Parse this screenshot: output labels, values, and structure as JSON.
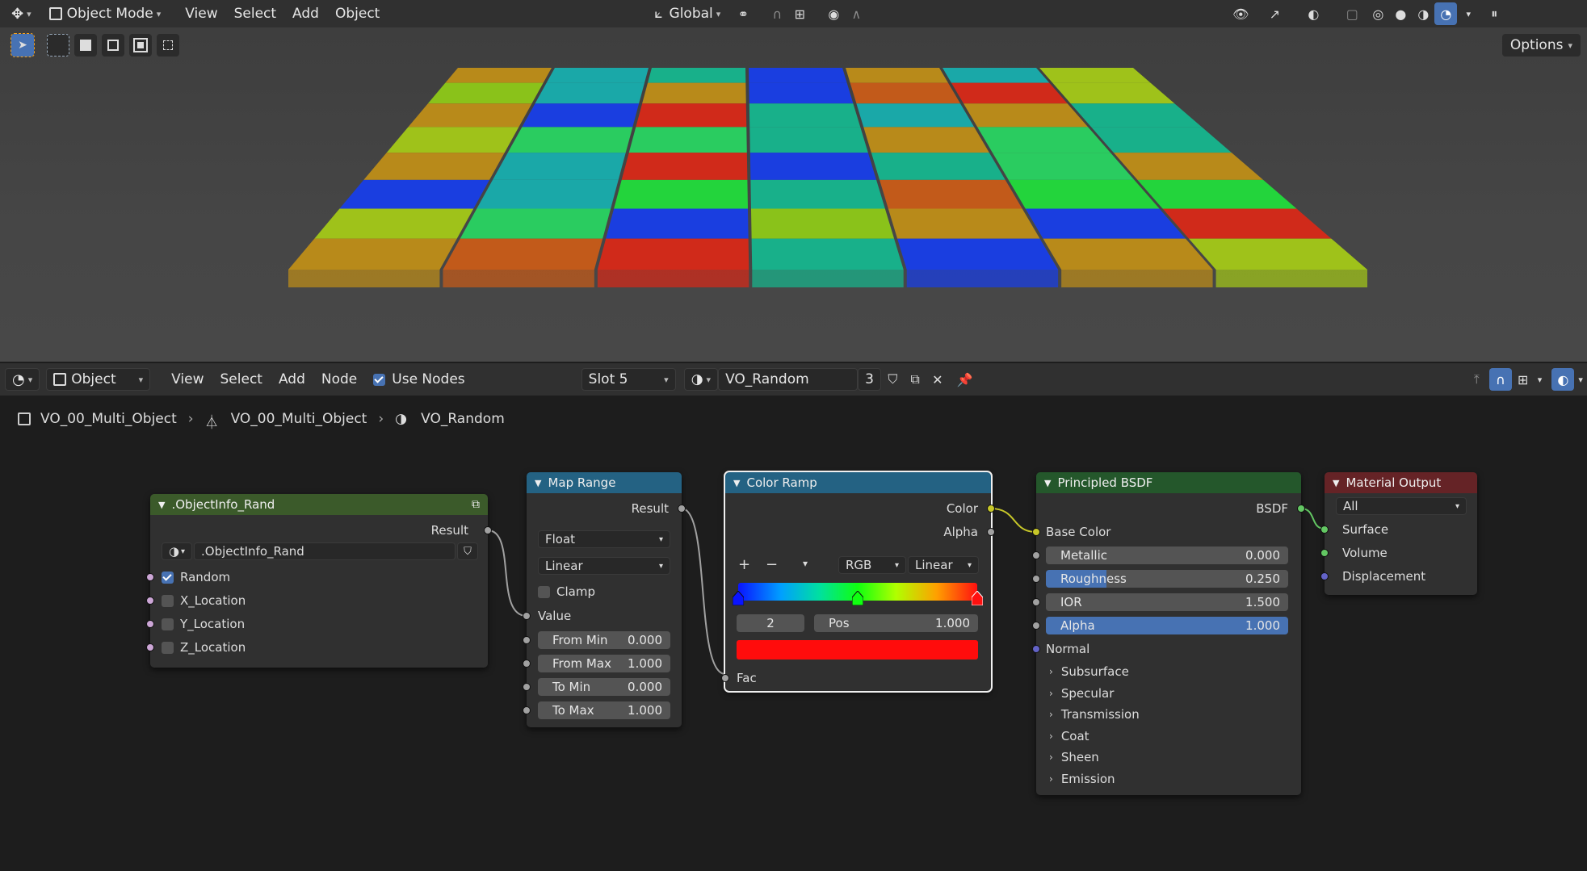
{
  "viewport_header": {
    "mode": "Object Mode",
    "menus": [
      "View",
      "Select",
      "Add",
      "Object"
    ],
    "orientation": "Global",
    "options_label": "Options"
  },
  "node_header": {
    "type": "Object",
    "menus": [
      "View",
      "Select",
      "Add",
      "Node"
    ],
    "use_nodes_label": "Use Nodes",
    "use_nodes_checked": true,
    "slot": "Slot 5",
    "material_name": "VO_Random",
    "user_count": "3"
  },
  "breadcrumb": {
    "object": "VO_00_Multi_Object",
    "mesh": "VO_00_Multi_Object",
    "material": "VO_Random"
  },
  "nodes": {
    "objectinfo": {
      "title": ".ObjectInfo_Rand",
      "output": "Result",
      "group_name": ".ObjectInfo_Rand",
      "inputs": [
        {
          "label": "Random",
          "checked": true
        },
        {
          "label": "X_Location",
          "checked": false
        },
        {
          "label": "Y_Location",
          "checked": false
        },
        {
          "label": "Z_Location",
          "checked": false
        }
      ]
    },
    "maprange": {
      "title": "Map Range",
      "output": "Result",
      "data_type": "Float",
      "interpolation": "Linear",
      "clamp_label": "Clamp",
      "value_label": "Value",
      "fields": [
        {
          "label": "From Min",
          "value": "0.000"
        },
        {
          "label": "From Max",
          "value": "1.000"
        },
        {
          "label": "To Min",
          "value": "0.000"
        },
        {
          "label": "To Max",
          "value": "1.000"
        }
      ]
    },
    "colorramp": {
      "title": "Color Ramp",
      "out_color": "Color",
      "out_alpha": "Alpha",
      "color_mode": "RGB",
      "interpolation": "Linear",
      "stop_index": "2",
      "pos_label": "Pos",
      "pos_value": "1.000",
      "stops": [
        {
          "pos": 0.0,
          "color": "#0a14ff"
        },
        {
          "pos": 0.5,
          "color": "#10ff10"
        },
        {
          "pos": 1.0,
          "color": "#ff1010"
        }
      ],
      "selected_color": "#ff0c0c",
      "input": "Fac"
    },
    "bsdf": {
      "title": "Principled BSDF",
      "output": "BSDF",
      "base_color_label": "Base Color",
      "fields": [
        {
          "label": "Metallic",
          "value": "0.000",
          "fill": 0.0
        },
        {
          "label": "Roughness",
          "value": "0.250",
          "fill": 0.25
        },
        {
          "label": "IOR",
          "value": "1.500",
          "fill": 0.0
        },
        {
          "label": "Alpha",
          "value": "1.000",
          "fill": 1.0
        }
      ],
      "normal_label": "Normal",
      "panels": [
        "Subsurface",
        "Specular",
        "Transmission",
        "Coat",
        "Sheen",
        "Emission"
      ]
    },
    "output": {
      "title": "Material Output",
      "target": "All",
      "inputs": [
        "Surface",
        "Volume",
        "Displacement"
      ]
    }
  },
  "colors": {
    "accent": "#4772b3",
    "header_shader": "#24572b",
    "header_converter": "#246283",
    "header_group": "#3b5a2a",
    "header_output": "#652326"
  }
}
